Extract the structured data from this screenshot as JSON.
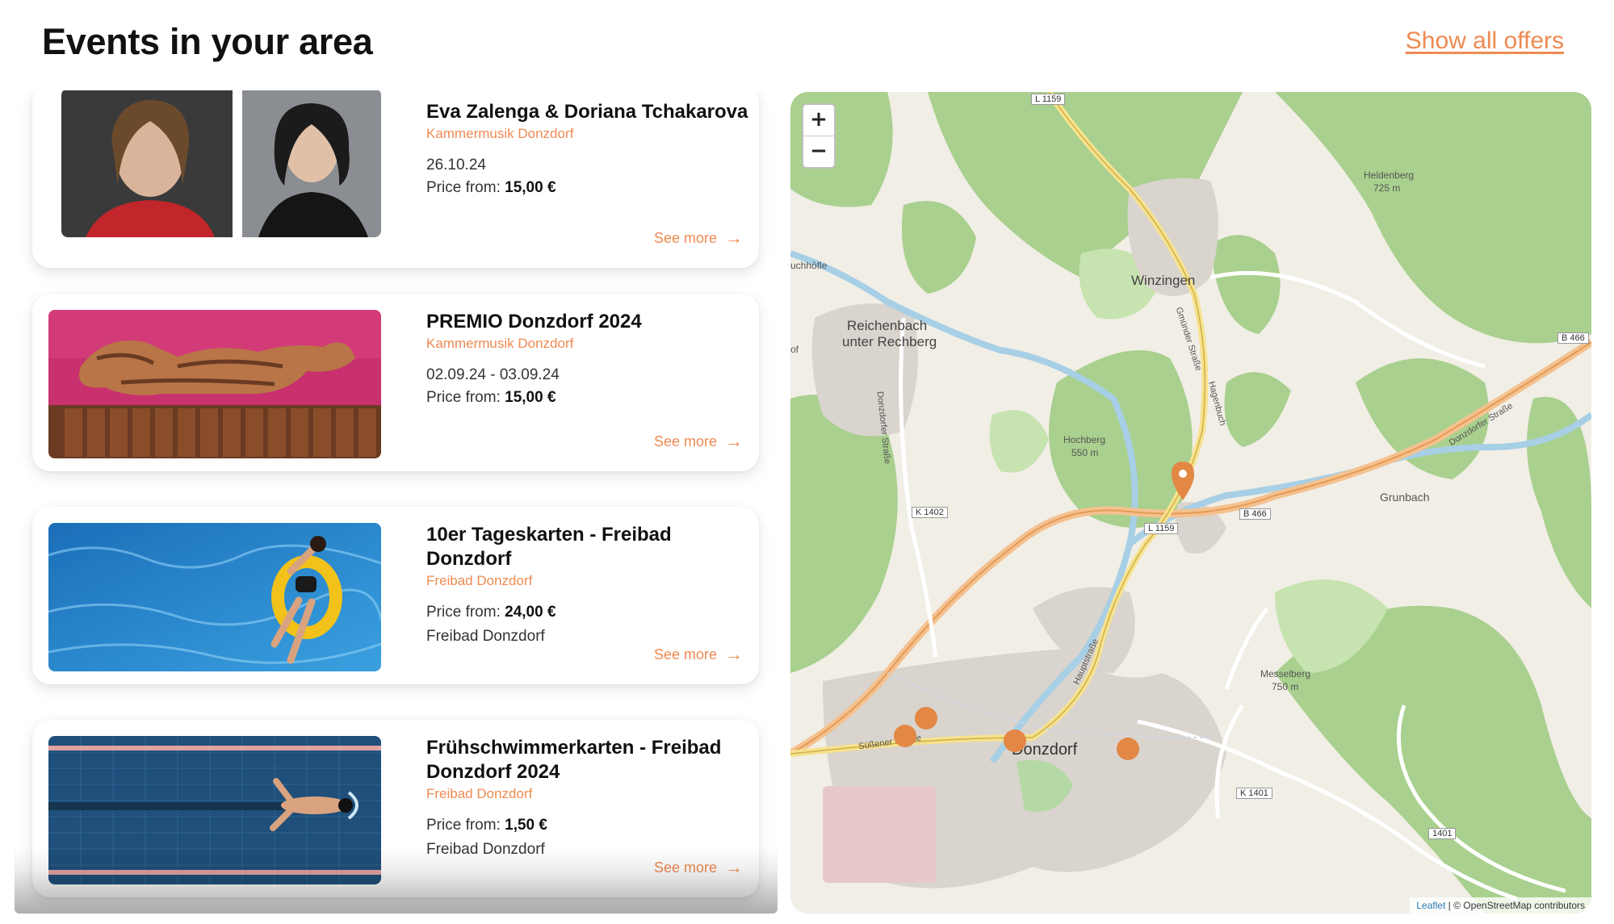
{
  "header": {
    "title": "Events in your area",
    "show_all": "Show all offers"
  },
  "events": [
    {
      "title": "Eva Zalenga & Doriana Tchakarova",
      "organizer": "Kammermusik Donzdorf",
      "date": "26.10.24",
      "price_label": "Price from:",
      "price": "15,00 €",
      "location": "",
      "see_more": "See more"
    },
    {
      "title": "PREMIO Donzdorf 2024",
      "organizer": "Kammermusik Donzdorf",
      "date": "02.09.24 - 03.09.24",
      "price_label": "Price from:",
      "price": "15,00 €",
      "location": "",
      "see_more": "See more"
    },
    {
      "title": "10er Tageskarten - Freibad Donzdorf",
      "organizer": "Freibad Donzdorf",
      "date": "",
      "price_label": "Price from:",
      "price": "24,00 €",
      "location": "Freibad Donzdorf",
      "see_more": "See more"
    },
    {
      "title": "Frühschwimmerkarten - Freibad Donzdorf 2024",
      "organizer": "Freibad Donzdorf",
      "date": "",
      "price_label": "Price from:",
      "price": "1,50 €",
      "location": "Freibad Donzdorf",
      "see_more": "See more"
    }
  ],
  "map": {
    "zoom_in": "+",
    "zoom_out": "−",
    "attribution_leaflet": "Leaflet",
    "attribution_rest": " | © OpenStreetMap contributors",
    "places": [
      "Winzingen",
      "Reichenbach",
      "unter Rechberg",
      "Donzdorf",
      "Grunbach",
      "Heldenberg",
      "725 m",
      "Hochberg",
      "550 m",
      "Messelberg",
      "750 m",
      "uchhöfle",
      "of"
    ],
    "roads": [
      "L 1159",
      "B 466",
      "K 1402",
      "L 1159",
      "B 466",
      "K 1401",
      "1401"
    ],
    "streets": [
      "Gmünder Straße",
      "Hagenbuch",
      "Donzdorfer Straße",
      "Donzdorfer Straße",
      "Hauptstraße",
      "Süßener Straße"
    ]
  },
  "colors": {
    "accent": "#ee8a52",
    "marker": "#e38745"
  }
}
